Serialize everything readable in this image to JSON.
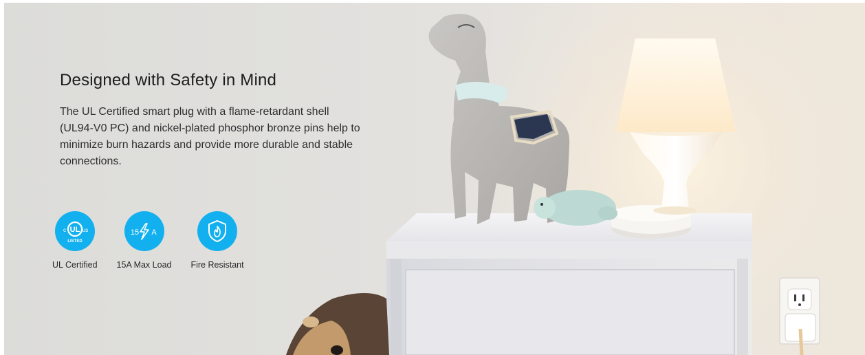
{
  "headline": "Designed with Safety in Mind",
  "body": "The  UL Certified smart plug with a flame-retardant shell (UL94-V0 PC) and nickel-plated phosphor bronze pins help to minimize burn hazards and provide more durable and stable connections.",
  "features": [
    {
      "icon": "ul-listed-icon",
      "label": "UL Certified",
      "badge_text": "UL",
      "badge_left": "c",
      "badge_right": "us",
      "badge_bottom": "LISTED"
    },
    {
      "icon": "lightning-15a-icon",
      "label": "15A Max Load",
      "badge_left": "15",
      "badge_right": "A"
    },
    {
      "icon": "fire-shield-icon",
      "label": "Fire Resistant"
    }
  ],
  "colors": {
    "icon_circle": "#12b0ef",
    "heading": "#1c1c1c",
    "body": "#2e2e2e",
    "wall": "#e1e0dd"
  }
}
